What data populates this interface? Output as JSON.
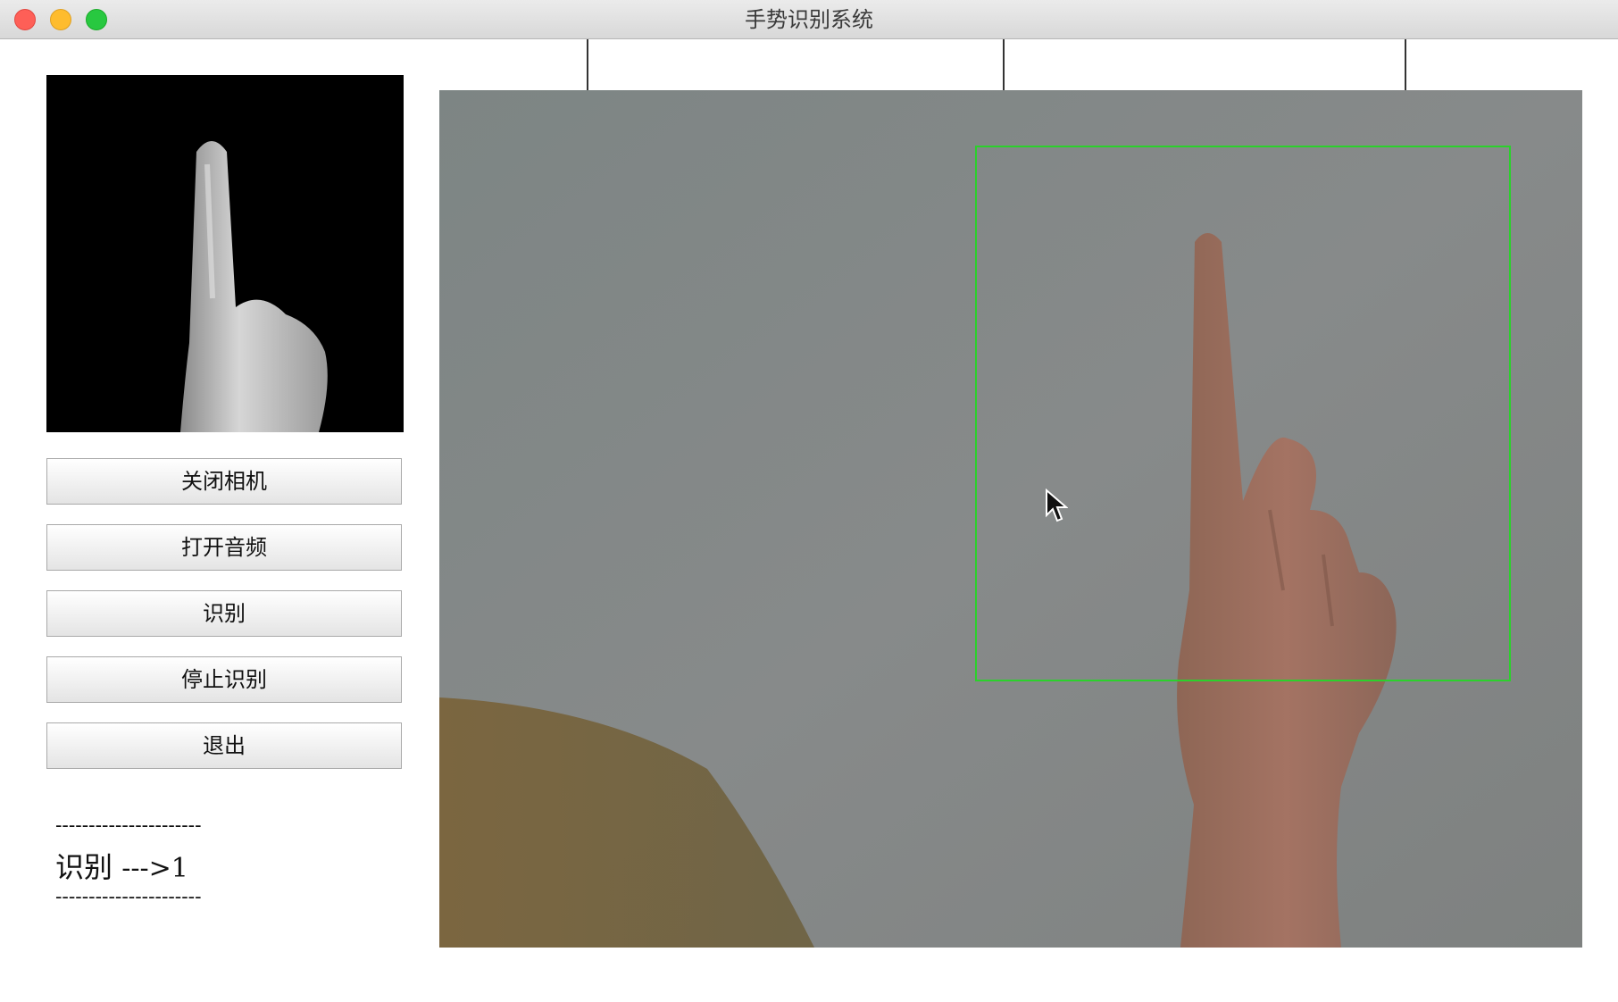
{
  "window": {
    "title": "手势识别系统"
  },
  "buttons": {
    "close_camera": "关闭相机",
    "open_audio": "打开音频",
    "recognize": "识别",
    "stop_recognize": "停止识别",
    "exit": "退出"
  },
  "result": {
    "separator": "----------------------",
    "label": "识别",
    "arrow_value": "--->1"
  },
  "colors": {
    "roi_box": "#2bd12b",
    "close": "#fe5f57",
    "minimize": "#febc2e",
    "maximize": "#28c840"
  }
}
